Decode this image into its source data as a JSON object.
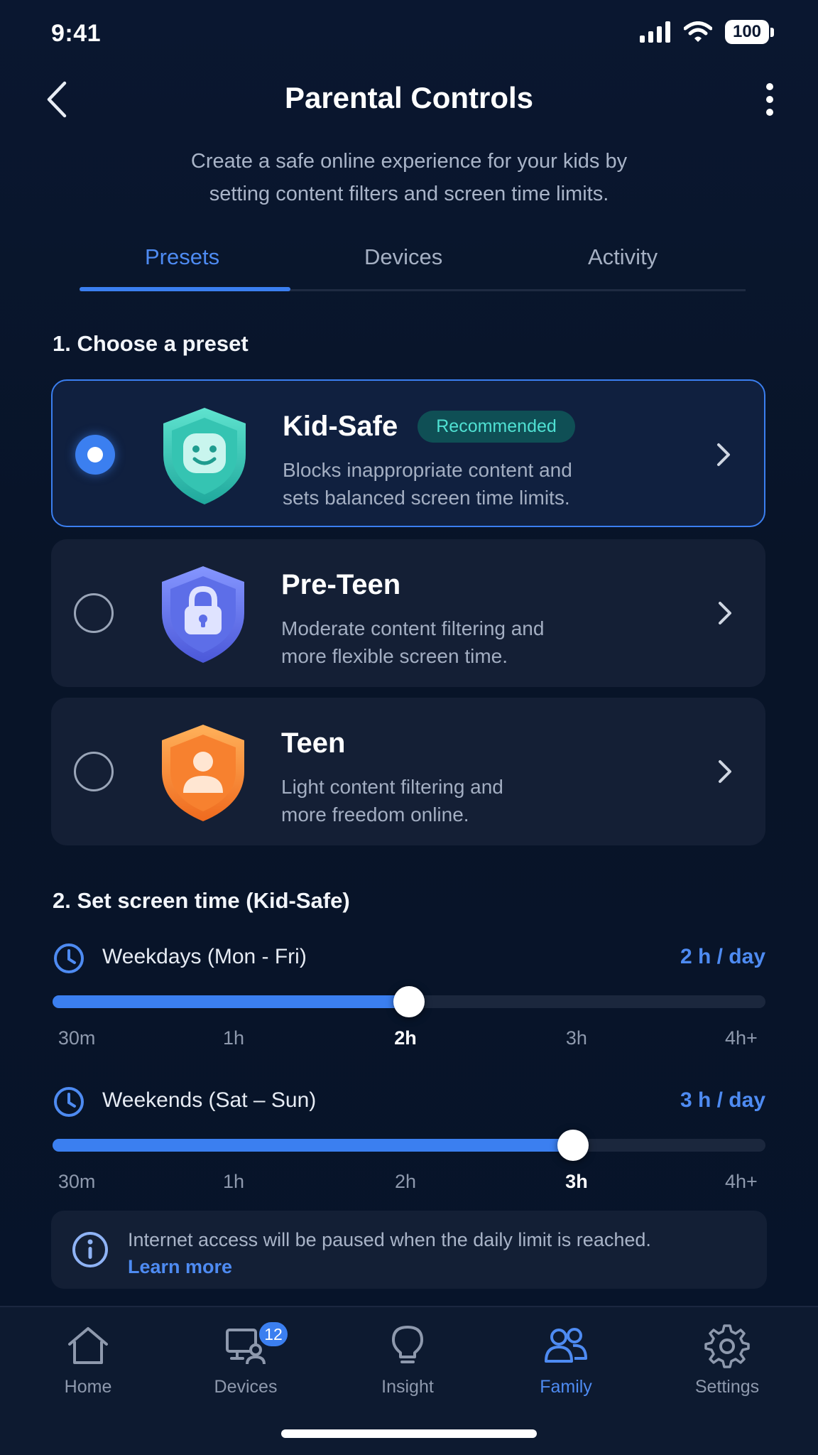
{
  "status_bar": {
    "time": "9:41",
    "battery": "100"
  },
  "header": {
    "title": "Parental Controls"
  },
  "subtitle": {
    "line1": "Create a safe online experience for your kids by",
    "line2": "setting content filters and screen time limits."
  },
  "tabs": [
    {
      "label": "Presets",
      "active": true
    },
    {
      "label": "Devices",
      "active": false
    },
    {
      "label": "Activity",
      "active": false
    }
  ],
  "presets_section": {
    "title": "1. Choose a preset",
    "items": [
      {
        "name": "Kid-Safe",
        "badge": "Recommended",
        "desc_line1": "Blocks inappropriate content and",
        "desc_line2": "sets balanced screen time limits.",
        "selected": true,
        "icon": "smiley-shield-icon",
        "color": "#3ccfbf"
      },
      {
        "name": "Pre-Teen",
        "desc_line1": "Moderate content filtering and",
        "desc_line2": "more flexible screen time.",
        "selected": false,
        "icon": "lock-shield-icon",
        "color": "#6b7cf5"
      },
      {
        "name": "Teen",
        "desc_line1": "Light content filtering and",
        "desc_line2": "more freedom online.",
        "selected": false,
        "icon": "person-shield-icon",
        "color": "#f78a34"
      }
    ]
  },
  "screen_time": {
    "title": "2. Set screen time (Kid-Safe)",
    "tick_labels": [
      "30m",
      "1h",
      "2h",
      "3h",
      "4h+"
    ],
    "weekdays": {
      "label": "Weekdays (Mon - Fri)",
      "value": "2 h / day",
      "selected_tick": "2h",
      "fraction": 0.5
    },
    "weekends": {
      "label": "Weekends (Sat – Sun)",
      "value": "3 h / day",
      "selected_tick": "3h",
      "fraction": 0.73
    }
  },
  "info": {
    "text": "Internet access will be paused when the daily limit is reached.",
    "link": "Learn more"
  },
  "bottom_nav": [
    {
      "label": "Home",
      "icon": "home-icon",
      "active": false
    },
    {
      "label": "Devices",
      "icon": "devices-icon",
      "badge": "12",
      "active": false
    },
    {
      "label": "Insight",
      "icon": "lightbulb-icon",
      "active": false
    },
    {
      "label": "Family",
      "icon": "family-icon",
      "active": true
    },
    {
      "label": "Settings",
      "icon": "gear-icon",
      "active": false
    }
  ],
  "colors": {
    "accent": "#3b7ff0",
    "background": "#081428",
    "card": "#141f35",
    "badge_text": "#4fe0d2"
  }
}
